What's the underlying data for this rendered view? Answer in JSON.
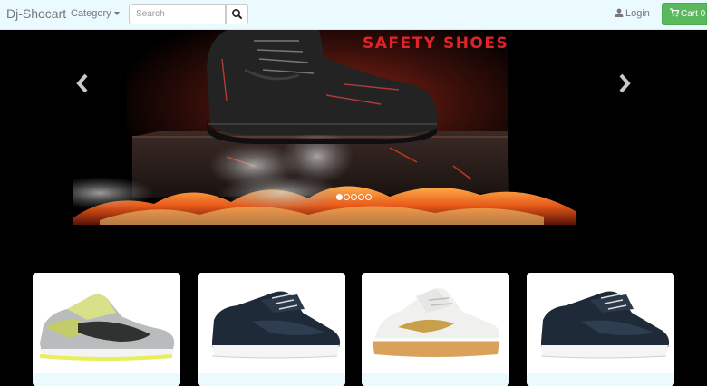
{
  "navbar": {
    "brand": "Dj-Shocart",
    "category_label": "Category",
    "search_placeholder": "Search",
    "login_label": "Login",
    "cart_label": "Cart 0"
  },
  "carousel": {
    "slide_title": "SAFETY SHOES",
    "slide_count": 5,
    "active_slide": 1
  },
  "products": [
    {
      "icon": "yellow-grey-sneaker"
    },
    {
      "icon": "navy-white-sneaker"
    },
    {
      "icon": "white-gold-sneaker"
    },
    {
      "icon": "navy-white-sneaker"
    }
  ],
  "colors": {
    "navbar_bg": "#eafaff",
    "cart_green": "#5cb85c",
    "banner_red": "#e0242c"
  }
}
